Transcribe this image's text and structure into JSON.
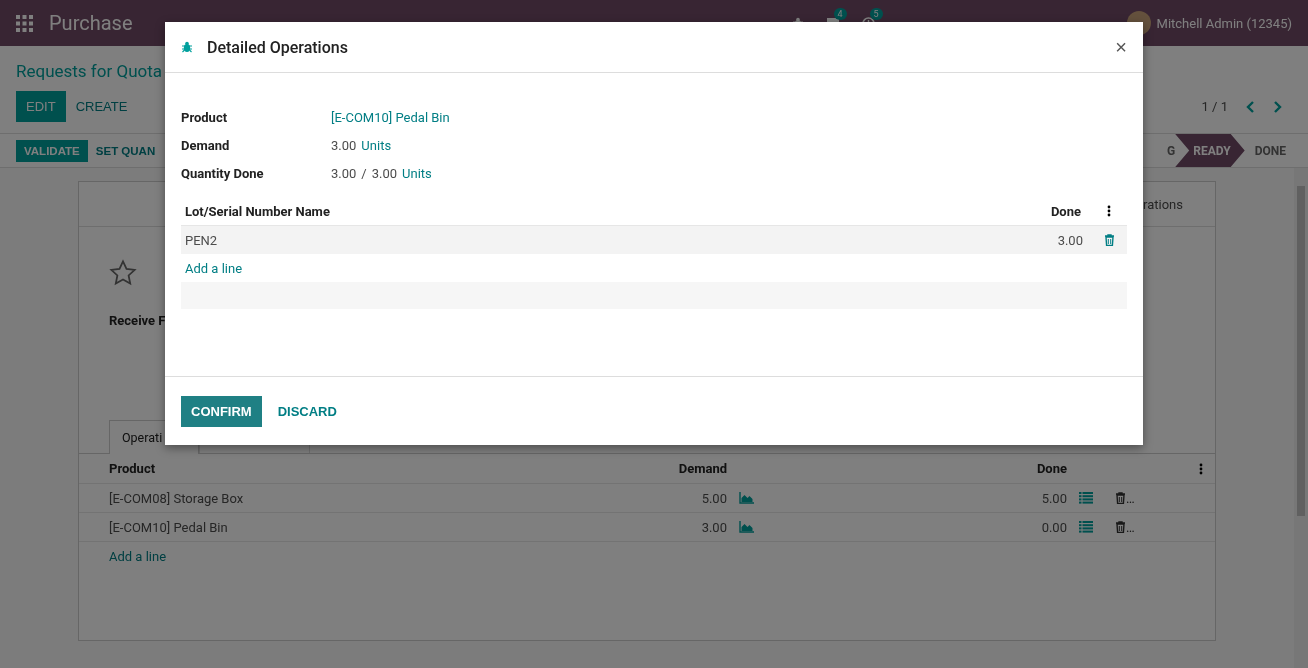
{
  "navbar": {
    "app": "Purchase",
    "messages_badge": "4",
    "activities_badge": "5",
    "user": "Mitchell Admin (12345)"
  },
  "breadcrumb": "Requests for Quota",
  "actions": [
    "EDIT",
    "CREATE"
  ],
  "pager": "1 / 1",
  "header_buttons": [
    "VALIDATE",
    "SET QUAN"
  ],
  "stages": [
    {
      "label": "G",
      "selected": false
    },
    {
      "label": "READY",
      "selected": true
    },
    {
      "label": "DONE",
      "selected": false
    }
  ],
  "sheet": {
    "smart_button": "rations",
    "field_label": "Receive F",
    "tabs": [
      {
        "label": "Operati",
        "selected": true
      },
      {
        "selected": false
      },
      {
        "selected": false
      }
    ],
    "columns": [
      "Product",
      "Demand",
      "Done"
    ],
    "rows": [
      {
        "product": "[E-COM08] Storage Box",
        "demand": "5.00",
        "done": "5.00",
        "delete": "…"
      },
      {
        "product": "[E-COM10] Pedal Bin",
        "demand": "3.00",
        "done": "0.00",
        "delete": "…"
      }
    ],
    "add_line": "Add a line"
  },
  "dialog": {
    "title": "Detailed Operations",
    "close": "×",
    "fields": [
      {
        "kind": "link",
        "label": "Product",
        "value": "[E-COM10] Pedal Bin"
      },
      {
        "kind": "quantity",
        "label": "Demand",
        "value": "3.00",
        "unit": "Units"
      },
      {
        "kind": "progress",
        "label": "Quantity Done",
        "value": "3.00",
        "separator": "/",
        "total": "3.00",
        "unit": "Units"
      }
    ],
    "columns": [
      "Lot/Serial Number Name",
      "Done"
    ],
    "rows": [
      {
        "lot": "PEN2",
        "done": "3.00"
      }
    ],
    "add_line": "Add a line",
    "buttons": [
      {
        "label": "CONFIRM",
        "kind": "primary"
      },
      {
        "label": "DISCARD",
        "kind": "secondary"
      }
    ]
  }
}
